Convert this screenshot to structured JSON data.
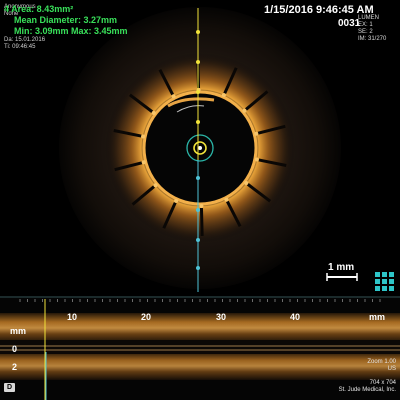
{
  "header": {
    "patient_line1": "Anonymous",
    "patient_line2": "None",
    "date_line": "Da: 15.01.2016",
    "time_line": "Ti: 09:46:45",
    "timestamp": "1/15/2016 9:46:45 AM",
    "frame_number": "0031",
    "info_right": [
      "LUMEN",
      "EX: 1",
      "SE: 2",
      "IM: 31/270"
    ]
  },
  "measurements": {
    "area": "4 Area: 8.43mm²",
    "mean_diameter": "Mean Diameter: 3.27mm",
    "min_max": "Min: 3.09mm   Max: 3.45mm",
    "color": "#39e05a"
  },
  "scale_bar": {
    "label": "1 mm"
  },
  "longitudinal": {
    "unit_left": "mm",
    "unit_right": "mm",
    "x_ticks": [
      "10",
      "20",
      "30",
      "40"
    ],
    "y_ticks": [
      "0",
      "2"
    ],
    "d_badge": "D"
  },
  "footer": {
    "zoom": "Zoom 1.00",
    "us": "US",
    "resolution": "704 x 704",
    "vendor": "St. Jude Medical, Inc."
  },
  "colors": {
    "tissue": "#d9972f",
    "guide_line": "#4fc3d7",
    "marker_yellow": "#f2e33a",
    "accent_teal": "#2ec5c8"
  },
  "icons": [
    "grid-view-icon"
  ]
}
